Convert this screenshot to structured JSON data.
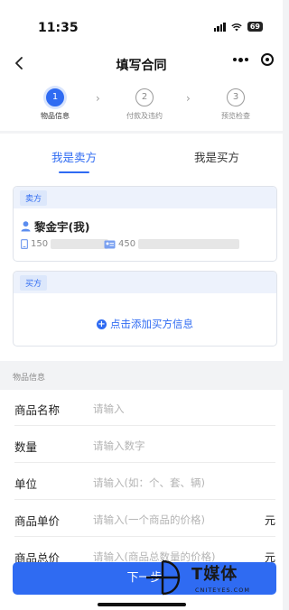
{
  "status": {
    "time": "11:35",
    "battery": "69"
  },
  "nav": {
    "title": "填写合同"
  },
  "steps": [
    {
      "number": "1",
      "label": "物品信息",
      "active": true
    },
    {
      "number": "2",
      "label": "付款及违约",
      "active": false
    },
    {
      "number": "3",
      "label": "预览检查",
      "active": false
    }
  ],
  "tabs": {
    "seller": "我是卖方",
    "buyer": "我是买方"
  },
  "seller_card": {
    "tag": "卖方",
    "name": "黎金宇(我)",
    "phone": "150",
    "id_number": "450"
  },
  "buyer_card": {
    "tag": "买方",
    "add_label": "点击添加买方信息"
  },
  "form": {
    "section_label": "物品信息",
    "rows": [
      {
        "label": "商品名称",
        "placeholder": "请输入",
        "unit": ""
      },
      {
        "label": "数量",
        "placeholder": "请输入数字",
        "unit": ""
      },
      {
        "label": "单位",
        "placeholder": "请输入(如：个、套、辆)",
        "unit": ""
      },
      {
        "label": "商品单价",
        "placeholder": "请输入(一个商品的价格)",
        "unit": "元"
      },
      {
        "label": "商品总价",
        "placeholder": "请输入(商品总数量的价格)",
        "unit": "元"
      }
    ]
  },
  "next_button": "下一步",
  "watermark": {
    "brand": "T媒体",
    "site": "CNITEYES.COM"
  }
}
